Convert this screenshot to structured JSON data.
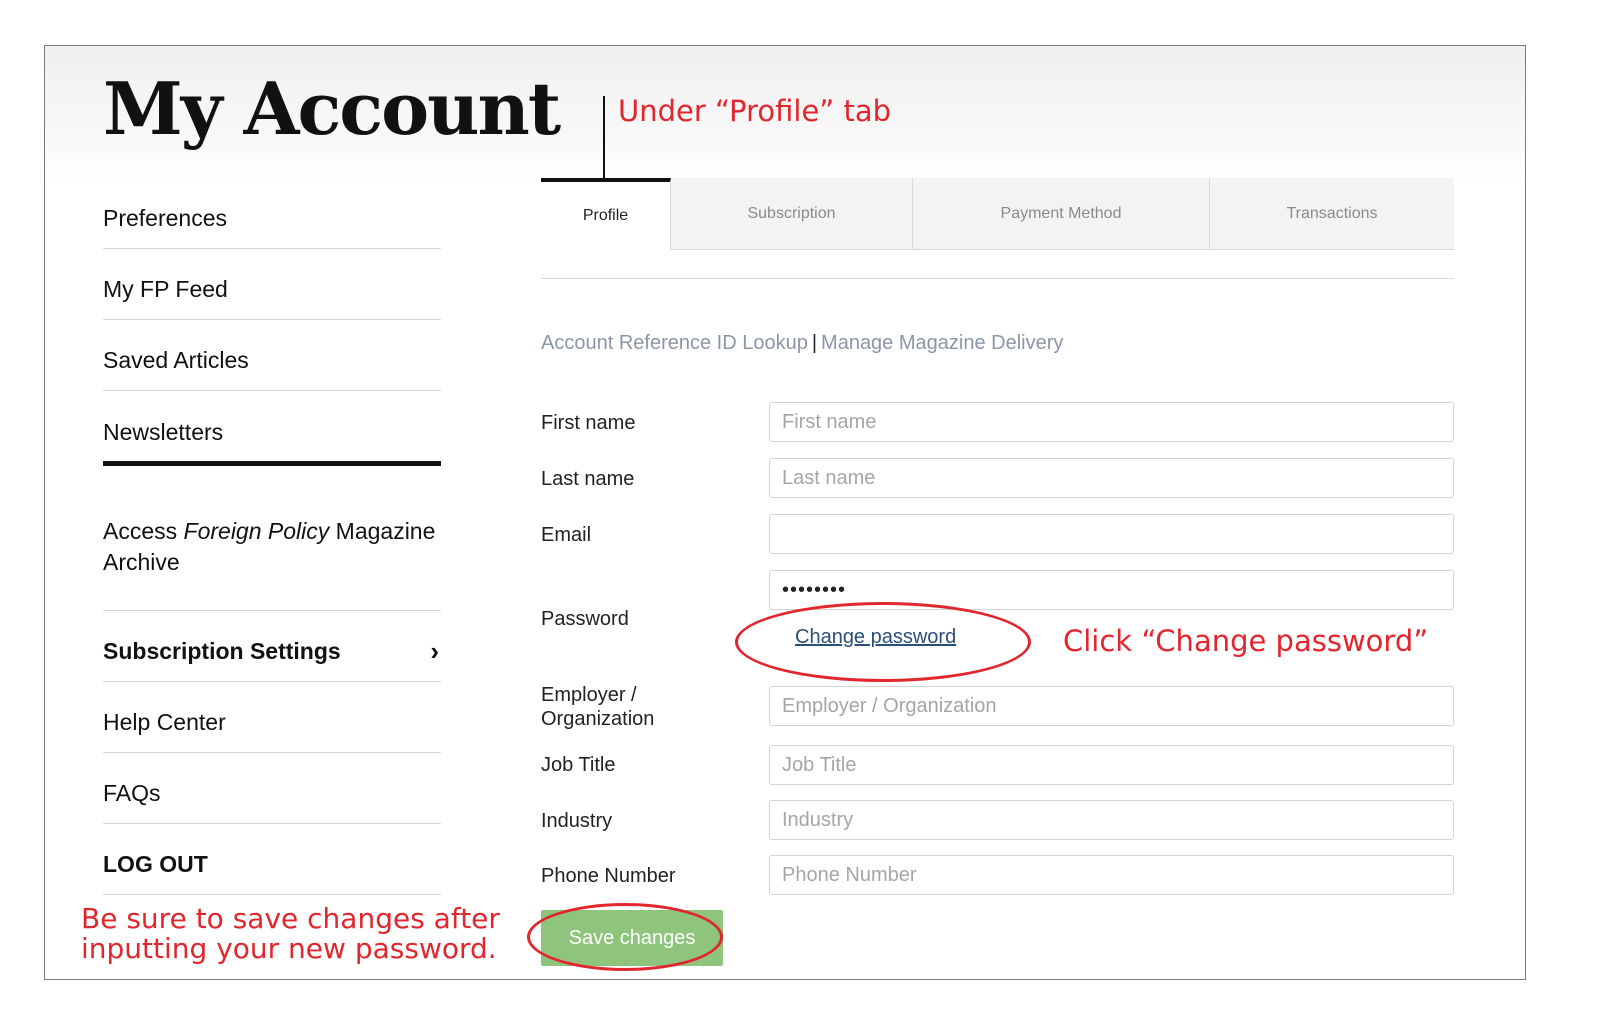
{
  "page": {
    "title": "My Account"
  },
  "annotations": {
    "profile_tab": "Under “Profile” tab",
    "change_password": "Click “Change password”",
    "save_line1": "Be sure to save changes after",
    "save_line2": "inputting your new password."
  },
  "sidebar": {
    "items": [
      {
        "label": "Preferences"
      },
      {
        "label": "My FP Feed"
      },
      {
        "label": "Saved Articles"
      },
      {
        "label": "Newsletters"
      }
    ],
    "archive": {
      "prefix": "Access ",
      "italic": "Foreign Policy",
      "suffix": " Magazine Archive"
    },
    "subscription_settings": "Subscription Settings",
    "chevron_glyph": "›",
    "help_center": "Help Center",
    "faqs": "FAQs",
    "logout": "LOG OUT"
  },
  "tabs": [
    {
      "label": "Profile",
      "active": true
    },
    {
      "label": "Subscription",
      "active": false
    },
    {
      "label": "Payment Method",
      "active": false
    },
    {
      "label": "Transactions",
      "active": false
    }
  ],
  "links": {
    "account_ref": "Account Reference ID Lookup",
    "separator": "|",
    "magazine_delivery": "Manage Magazine Delivery"
  },
  "form": {
    "first_name": {
      "label": "First name",
      "placeholder": "First name",
      "value": ""
    },
    "last_name": {
      "label": "Last name",
      "placeholder": "Last name",
      "value": ""
    },
    "email": {
      "label": "Email",
      "placeholder": "",
      "value": ""
    },
    "password": {
      "label": "Password",
      "value": "••••••••"
    },
    "change_password": "Change password",
    "employer": {
      "label_line1": "Employer /",
      "label_line2": "Organization",
      "placeholder": "Employer / Organization",
      "value": ""
    },
    "job_title": {
      "label": "Job Title",
      "placeholder": "Job Title",
      "value": ""
    },
    "industry": {
      "label": "Industry",
      "placeholder": "Industry",
      "value": ""
    },
    "phone": {
      "label": "Phone Number",
      "placeholder": "Phone Number",
      "value": ""
    },
    "save_button": "Save changes"
  },
  "colors": {
    "annotation_red": "#e1262d",
    "save_green": "#8fc47c",
    "link_grey_blue": "#8a96a8",
    "change_link_blue": "#2a4f7a"
  }
}
